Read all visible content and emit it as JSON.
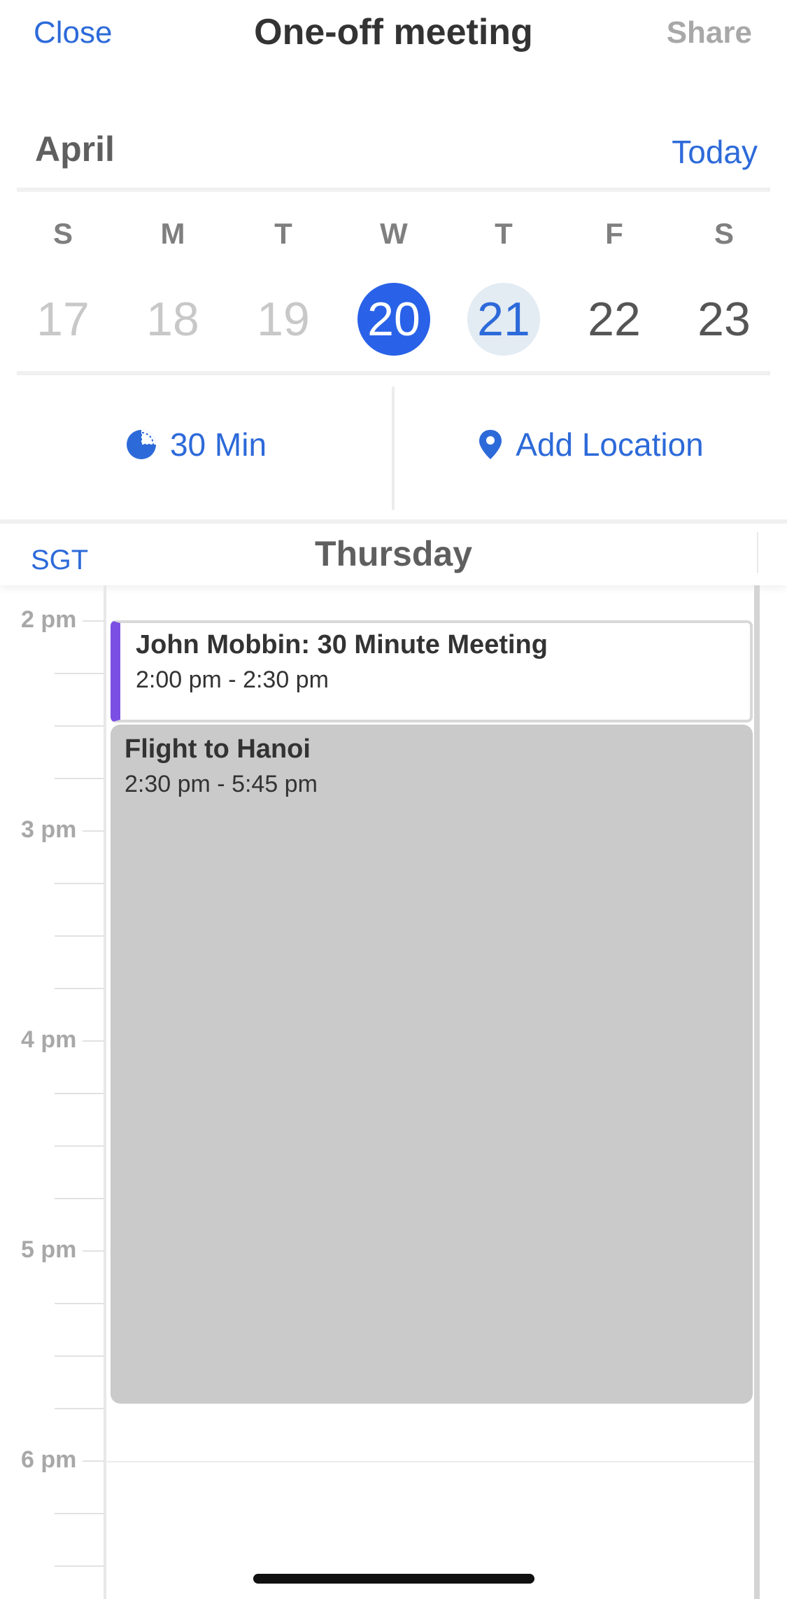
{
  "nav": {
    "close_label": "Close",
    "title": "One-off meeting",
    "share_label": "Share"
  },
  "calendar": {
    "month": "April",
    "today_label": "Today",
    "weekdays": [
      "S",
      "M",
      "T",
      "W",
      "T",
      "F",
      "S"
    ],
    "dates": [
      "17",
      "18",
      "19",
      "20",
      "21",
      "22",
      "23"
    ],
    "selected_date": "20",
    "today_date": "21"
  },
  "options": {
    "duration_label": "30 Min",
    "duration_icon": "timer-pie-icon",
    "location_label": "Add Location",
    "location_icon": "map-pin-icon"
  },
  "day_view": {
    "timezone": "SGT",
    "day_name": "Thursday",
    "hours": [
      "2 pm",
      "3 pm",
      "4 pm",
      "5 pm",
      "6 pm"
    ],
    "events": [
      {
        "title": "John Mobbin: 30 Minute Meeting",
        "time": "2:00 pm - 2:30 pm",
        "accent": "#7b4fe3"
      },
      {
        "title": "Flight to Hanoi",
        "time": "2:30 pm - 5:45 pm",
        "color": "#cacaca"
      }
    ]
  },
  "colors": {
    "accent": "#2d6ad9",
    "selected_day": "#2962e8",
    "today_day": "#e3ebf3"
  }
}
